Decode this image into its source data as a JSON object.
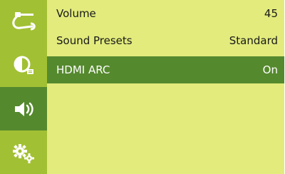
{
  "sidebar": {
    "items": [
      {
        "icon": "cable-connector-icon",
        "active": false
      },
      {
        "icon": "contrast-picture-icon",
        "active": false
      },
      {
        "icon": "speaker-sound-icon",
        "active": true
      },
      {
        "icon": "gears-settings-icon",
        "active": false
      }
    ]
  },
  "menu": {
    "rows": [
      {
        "label": "Volume",
        "value": "45",
        "selected": false
      },
      {
        "label": "Sound Presets",
        "value": "Standard",
        "selected": false
      },
      {
        "label": "HDMI ARC",
        "value": "On",
        "selected": true
      }
    ]
  },
  "colors": {
    "background": "#e2eb7c",
    "sidebar": "#a2c033",
    "selection": "#55892e",
    "selected_text": "#ffffff",
    "text": "#1a1a1a"
  }
}
